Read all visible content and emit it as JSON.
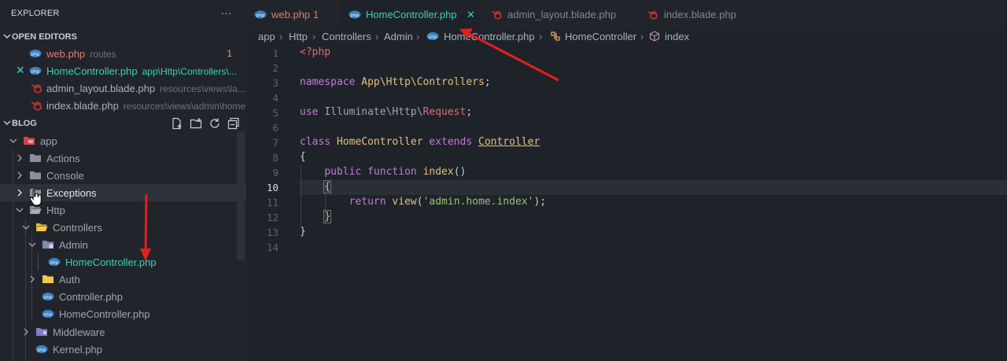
{
  "sidebar": {
    "title": "EXPLORER",
    "more_icon": "…",
    "open_editors": {
      "label": "OPEN EDITORS",
      "items": [
        {
          "name": "web.php",
          "desc": "routes",
          "badge": "1",
          "color": "#e07b6b",
          "icon": "php-icon"
        },
        {
          "name": "HomeController.php",
          "desc": "app\\Http\\Controllers\\...",
          "color": "#3fcfb5",
          "icon": "php-icon"
        },
        {
          "name": "admin_layout.blade.php",
          "desc": "resources\\views\\la...",
          "color": "#a9b1bd",
          "icon": "laravel-icon"
        },
        {
          "name": "index.blade.php",
          "desc": "resources\\views\\admin\\home",
          "color": "#a9b1bd",
          "icon": "laravel-icon"
        }
      ]
    },
    "project": {
      "label": "BLOG",
      "tree": [
        {
          "name": "app",
          "depth": 0,
          "type": "folder",
          "open": true
        },
        {
          "name": "Actions",
          "depth": 1,
          "type": "folder",
          "open": false
        },
        {
          "name": "Console",
          "depth": 1,
          "type": "folder",
          "open": false
        },
        {
          "name": "Exceptions",
          "depth": 1,
          "type": "folder",
          "open": false
        },
        {
          "name": "Http",
          "depth": 1,
          "type": "folder",
          "open": true
        },
        {
          "name": "Controllers",
          "depth": 2,
          "type": "folder",
          "open": true
        },
        {
          "name": "Admin",
          "depth": 3,
          "type": "folder",
          "open": true
        },
        {
          "name": "HomeController.php",
          "depth": 4,
          "type": "file"
        },
        {
          "name": "Auth",
          "depth": 3,
          "type": "folder",
          "open": false
        },
        {
          "name": "Controller.php",
          "depth": 3,
          "type": "file"
        },
        {
          "name": "HomeController.php",
          "depth": 3,
          "type": "file"
        },
        {
          "name": "Middleware",
          "depth": 2,
          "type": "folder",
          "open": false
        },
        {
          "name": "Kernel.php",
          "depth": 2,
          "type": "file"
        }
      ]
    }
  },
  "tabs": [
    {
      "label": "web.php",
      "suffix": "1",
      "color": "#e07b6b",
      "icon": "php-icon"
    },
    {
      "label": "HomeController.php",
      "close": "✕",
      "color": "#3fcfb5",
      "icon": "php-icon",
      "active": true
    },
    {
      "label": "admin_layout.blade.php",
      "color": "#7f8793",
      "icon": "laravel-icon"
    },
    {
      "label": "index.blade.php",
      "color": "#7f8793",
      "icon": "laravel-icon"
    }
  ],
  "breadcrumb": [
    "app",
    "Http",
    "Controllers",
    "Admin",
    "HomeController.php",
    "HomeController",
    "index"
  ],
  "editor": {
    "current_line": 10,
    "lines": [
      "1",
      "2",
      "3",
      "4",
      "5",
      "6",
      "7",
      "8",
      "9",
      "10",
      "11",
      "12",
      "13",
      "14"
    ],
    "code": {
      "l1": "<?php",
      "l3_kw": "namespace",
      "l3_ns": "App\\Http\\Controllers",
      "l3_end": ";",
      "l5_kw": "use",
      "l5_ns": "Illuminate\\Http\\",
      "l5_cls": "Request",
      "l5_end": ";",
      "l7_kw1": "class",
      "l7_name": "HomeController",
      "l7_kw2": "extends",
      "l7_parent": "Controller",
      "l8": "{",
      "l9_kw1": "public",
      "l9_kw2": "function",
      "l9_fn": "index",
      "l9_paren": "()",
      "l10": "{",
      "l11_kw": "return",
      "l11_fn": "view",
      "l11_open": "(",
      "l11_str": "'admin.home.index'",
      "l11_close": ");",
      "l12": "}",
      "l13": "}"
    }
  },
  "colors": {
    "accent": "#3fcfb5",
    "annotation_arrow": "#e0201e",
    "background": "#1e2329",
    "sidebar": "#21252b"
  }
}
